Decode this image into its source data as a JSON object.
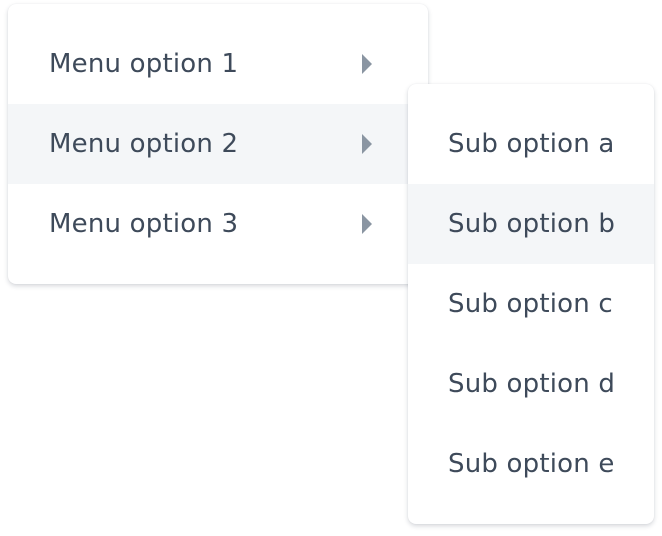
{
  "main_menu": {
    "items": [
      {
        "label": "Menu option 1",
        "icon": "caret-right-icon"
      },
      {
        "label": "Menu option 2",
        "icon": "caret-right-icon",
        "highlighted": true
      },
      {
        "label": "Menu option 3",
        "icon": "caret-right-icon"
      }
    ]
  },
  "sub_menu": {
    "items": [
      {
        "label": "Sub option a"
      },
      {
        "label": "Sub option b",
        "highlighted": true
      },
      {
        "label": "Sub option c"
      },
      {
        "label": "Sub option d"
      },
      {
        "label": "Sub option e"
      }
    ]
  },
  "colors": {
    "text": "#3e4a5a",
    "arrow": "#8a95a2",
    "highlight": "#f4f6f8",
    "surface": "#ffffff"
  }
}
